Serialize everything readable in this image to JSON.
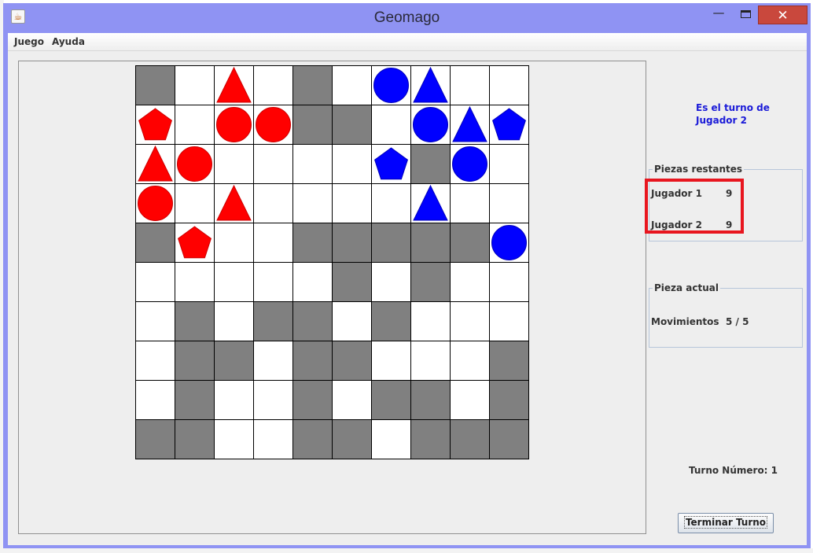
{
  "window": {
    "title": "Geomago",
    "close_glyph": "✕",
    "minimize_glyph": "—",
    "icon": "java-cup-icon"
  },
  "menu": {
    "items": [
      "Juego",
      "Ayuda"
    ]
  },
  "board": {
    "gray_cells": [
      [
        0,
        0
      ],
      [
        0,
        4
      ],
      [
        1,
        4
      ],
      [
        1,
        5
      ],
      [
        2,
        7
      ],
      [
        4,
        0
      ],
      [
        4,
        4
      ],
      [
        4,
        5
      ],
      [
        4,
        6
      ],
      [
        4,
        7
      ],
      [
        4,
        8
      ],
      [
        5,
        5
      ],
      [
        5,
        7
      ],
      [
        6,
        1
      ],
      [
        6,
        3
      ],
      [
        6,
        4
      ],
      [
        6,
        6
      ],
      [
        7,
        1
      ],
      [
        7,
        2
      ],
      [
        7,
        4
      ],
      [
        7,
        5
      ],
      [
        7,
        9
      ],
      [
        8,
        1
      ],
      [
        8,
        4
      ],
      [
        8,
        6
      ],
      [
        8,
        7
      ],
      [
        8,
        9
      ],
      [
        9,
        0
      ],
      [
        9,
        1
      ],
      [
        9,
        4
      ],
      [
        9,
        5
      ],
      [
        9,
        7
      ],
      [
        9,
        8
      ],
      [
        9,
        9
      ]
    ],
    "pieces": [
      {
        "row": 0,
        "col": 2,
        "shape": "triangle",
        "color": "red"
      },
      {
        "row": 0,
        "col": 6,
        "shape": "circle",
        "color": "blue"
      },
      {
        "row": 0,
        "col": 7,
        "shape": "triangle",
        "color": "blue"
      },
      {
        "row": 1,
        "col": 0,
        "shape": "pentagon",
        "color": "red"
      },
      {
        "row": 1,
        "col": 2,
        "shape": "circle",
        "color": "red"
      },
      {
        "row": 1,
        "col": 3,
        "shape": "circle",
        "color": "red"
      },
      {
        "row": 1,
        "col": 7,
        "shape": "circle",
        "color": "blue"
      },
      {
        "row": 1,
        "col": 8,
        "shape": "triangle",
        "color": "blue"
      },
      {
        "row": 1,
        "col": 9,
        "shape": "pentagon",
        "color": "blue"
      },
      {
        "row": 2,
        "col": 0,
        "shape": "triangle",
        "color": "red"
      },
      {
        "row": 2,
        "col": 1,
        "shape": "circle",
        "color": "red"
      },
      {
        "row": 2,
        "col": 6,
        "shape": "pentagon",
        "color": "blue"
      },
      {
        "row": 2,
        "col": 8,
        "shape": "circle",
        "color": "blue"
      },
      {
        "row": 3,
        "col": 0,
        "shape": "circle",
        "color": "red"
      },
      {
        "row": 3,
        "col": 2,
        "shape": "triangle",
        "color": "red"
      },
      {
        "row": 3,
        "col": 7,
        "shape": "triangle",
        "color": "blue"
      },
      {
        "row": 4,
        "col": 1,
        "shape": "pentagon",
        "color": "red"
      },
      {
        "row": 4,
        "col": 9,
        "shape": "circle",
        "color": "blue"
      }
    ],
    "colors": {
      "red": "#ff0000",
      "blue": "#0000ff",
      "gray": "#808080"
    }
  },
  "side": {
    "turn_line1": "Es el turno de",
    "turn_line2": "Jugador 2",
    "remaining": {
      "title": "Piezas restantes",
      "p1_label": "Jugador 1",
      "p1_value": "9",
      "p2_label": "Jugador 2",
      "p2_value": "9"
    },
    "current": {
      "title": "Pieza actual",
      "moves_label": "Movimientos",
      "moves_value": "5 / 5"
    },
    "turn_number": "Turno Número: 1",
    "end_turn_button": "Terminar Turno"
  }
}
